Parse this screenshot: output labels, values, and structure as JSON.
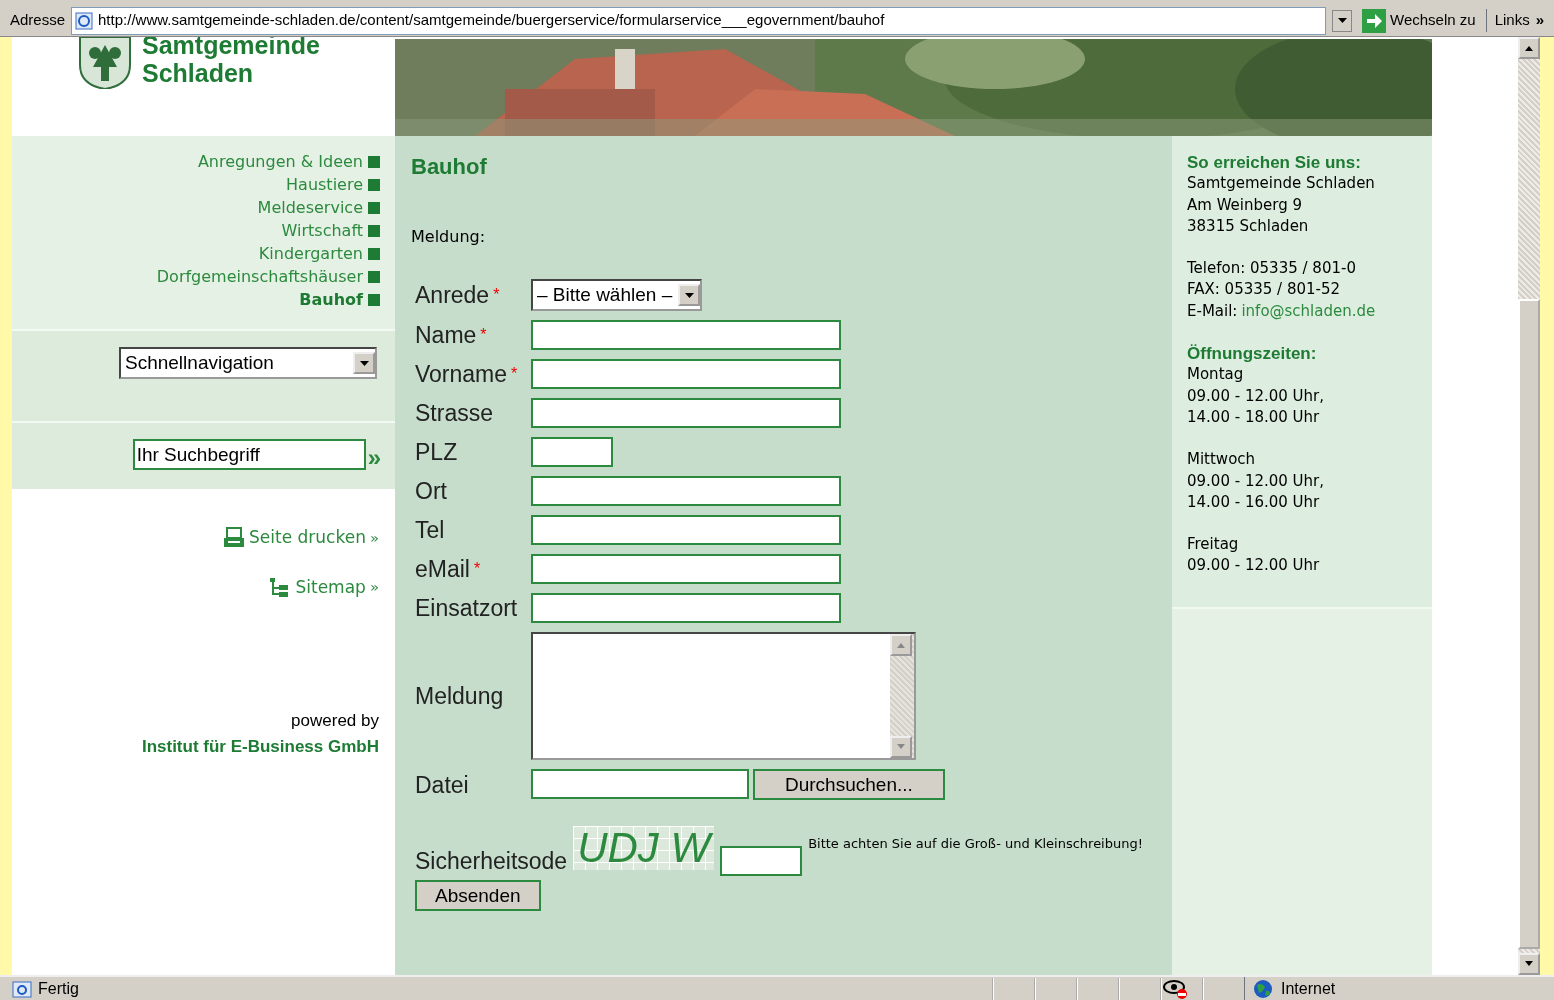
{
  "address_bar": {
    "label": "Adresse",
    "url": "http://www.samtgemeinde-schladen.de/content/samtgemeinde/buergerservice/formularservice___egovernment/bauhof",
    "go_label": "Wechseln zu",
    "links_label": "Links",
    "more": "»"
  },
  "site": {
    "logo_lines": [
      "Samtgemeinde",
      "Schladen"
    ]
  },
  "nav": {
    "items": [
      {
        "label": "Anregungen & Ideen",
        "selected": false
      },
      {
        "label": "Haustiere",
        "selected": false
      },
      {
        "label": "Meldeservice",
        "selected": false
      },
      {
        "label": "Wirtschaft",
        "selected": false
      },
      {
        "label": "Kindergarten",
        "selected": false
      },
      {
        "label": "Dorfgemeinschaftshäuser",
        "selected": false
      },
      {
        "label": "Bauhof",
        "selected": true
      }
    ]
  },
  "quick_nav": {
    "value": "Schnellnavigation"
  },
  "search": {
    "value": "Ihr Suchbegriff",
    "submit": "»"
  },
  "links": [
    {
      "kind": "print",
      "label": "Seite drucken",
      "arrow": "»"
    },
    {
      "kind": "sitemap",
      "label": "Sitemap",
      "arrow": "»"
    }
  ],
  "powered": {
    "label": "powered by",
    "company": "Institut für E-Business GmbH"
  },
  "form": {
    "title": "Bauhof",
    "subtitle": "Meldung:",
    "required_mark": "*",
    "fields": [
      {
        "label": "Anrede",
        "kind": "select",
        "required": true,
        "value": "– Bitte wählen –"
      },
      {
        "label": "Name",
        "kind": "text",
        "required": true
      },
      {
        "label": "Vorname",
        "kind": "text",
        "required": true
      },
      {
        "label": "Strasse",
        "kind": "text",
        "required": false
      },
      {
        "label": "PLZ",
        "kind": "short",
        "required": false
      },
      {
        "label": "Ort",
        "kind": "text",
        "required": false
      },
      {
        "label": "Tel",
        "kind": "text",
        "required": false
      },
      {
        "label": "eMail",
        "kind": "text",
        "required": true
      },
      {
        "label": "Einsatzort",
        "kind": "text",
        "required": false
      },
      {
        "label": "Meldung",
        "kind": "textarea",
        "required": false
      },
      {
        "label": "Datei",
        "kind": "file",
        "required": false,
        "button": "Durchsuchen..."
      }
    ],
    "captcha": {
      "label": "Sicherheitsode",
      "code": "UDJ W",
      "hint": "Bitte achten Sie auf die Groß- und Kleinschreibung!"
    },
    "submit": "Absenden"
  },
  "contact": {
    "heading": "So erreichen Sie uns:",
    "lines": [
      "Samtgemeinde Schladen",
      "Am Weinberg 9",
      "38315 Schladen"
    ],
    "phone_lines": [
      "Telefon: 05335 / 801-0",
      "FAX: 05335 / 801-52"
    ],
    "email_label": "E-Mail:",
    "email": "info@schladen.de",
    "hours_heading": "Öffnungszeiten:",
    "hours": [
      {
        "day": "Montag",
        "times": [
          "09.00 - 12.00 Uhr,",
          "14.00 - 18.00 Uhr"
        ]
      },
      {
        "day": "Mittwoch",
        "times": [
          "09.00 - 12.00 Uhr,",
          "14.00 - 16.00 Uhr"
        ]
      },
      {
        "day": "Freitag",
        "times": [
          "09.00 - 12.00 Uhr"
        ]
      }
    ]
  },
  "status_bar": {
    "text": "Fertig",
    "zone": "Internet"
  }
}
